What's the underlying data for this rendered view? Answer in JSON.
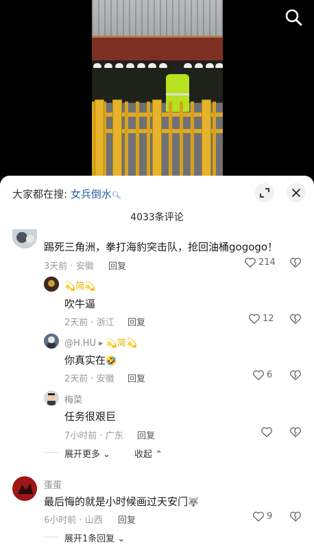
{
  "video": {
    "description_icon": "search-icon"
  },
  "sheet": {
    "hot_search_prefix": "大家都在搜:",
    "hot_search_keyword": "女兵倒水",
    "comment_count": "4033条评论"
  },
  "comments": {
    "c1": {
      "text": "踢死三角洲，拳打海豹突击队，抢回油桶gogogo！",
      "time": "3天前",
      "loc": "安徽",
      "reply": "回复",
      "likes": "214"
    },
    "r1": {
      "name_badge": "💫简💫",
      "text": "吹牛逼",
      "time": "2天前",
      "loc": "浙江",
      "reply": "回复",
      "likes": "12"
    },
    "r2": {
      "name": "@H.HU",
      "arrow": "▸",
      "name_badge": "💫简💫",
      "text": "你真实在",
      "time": "2天前",
      "loc": "安徽",
      "reply": "回复",
      "likes": "6"
    },
    "r3": {
      "name": "梅菜",
      "text": "任务很艰巨",
      "time": "7小时前",
      "loc": "广东",
      "reply": "回复"
    },
    "thread_controls": {
      "expand_more": "展开更多",
      "collapse": "收起"
    },
    "c2": {
      "name": "蛋蛋",
      "text": "最后悔的就是小时候画过天安门",
      "time": "6小时前",
      "loc": "山西",
      "reply": "回复",
      "likes": "9"
    },
    "c2_expand": "展开1条回复"
  },
  "colors": {
    "accent_link": "#2a5aa8",
    "guard_vest": "#b6e21f",
    "railing": "#e0ab22"
  }
}
